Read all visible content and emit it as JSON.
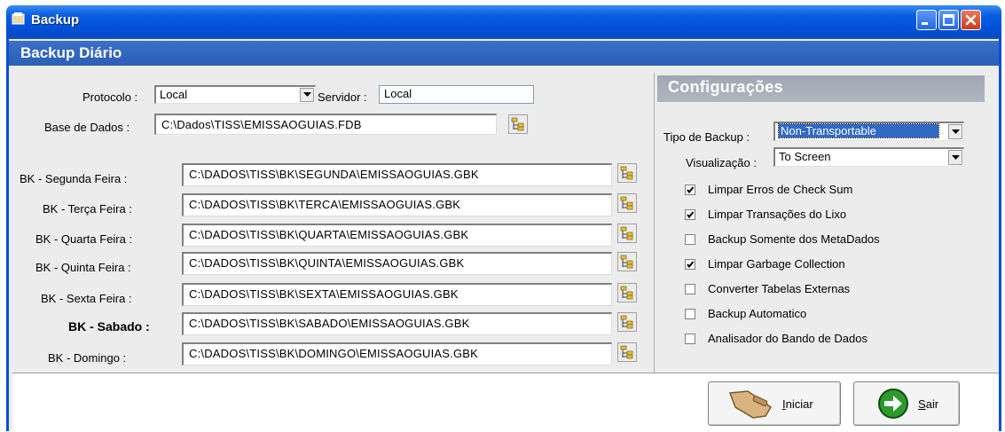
{
  "window": {
    "title": "Backup",
    "header": "Backup Diário"
  },
  "left": {
    "protocolo_label": "Protocolo :",
    "protocolo_value": "Local",
    "servidor_label": "Servidor :",
    "servidor_value": "Local",
    "base_label": "Base de Dados :",
    "base_value": "C:\\Dados\\TISS\\EMISSAOGUIAS.FDB",
    "days": [
      {
        "label": "BK - Segunda Feira :",
        "path": "C:\\DADOS\\TISS\\BK\\SEGUNDA\\EMISSAOGUIAS.GBK"
      },
      {
        "label": "BK - Terça Feira :",
        "path": "C:\\DADOS\\TISS\\BK\\TERCA\\EMISSAOGUIAS.GBK"
      },
      {
        "label": "BK - Quarta Feira :",
        "path": "C:\\DADOS\\TISS\\BK\\QUARTA\\EMISSAOGUIAS.GBK"
      },
      {
        "label": "BK - Quinta Feira :",
        "path": "C:\\DADOS\\TISS\\BK\\QUINTA\\EMISSAOGUIAS.GBK"
      },
      {
        "label": "BK - Sexta Feira :",
        "path": "C:\\DADOS\\TISS\\BK\\SEXTA\\EMISSAOGUIAS.GBK"
      },
      {
        "label": "BK - Sabado :",
        "path": "C:\\DADOS\\TISS\\BK\\SABADO\\EMISSAOGUIAS.GBK"
      },
      {
        "label": "BK - Domingo :",
        "path": "C:\\DADOS\\TISS\\BK\\DOMINGO\\EMISSAOGUIAS.GBK"
      }
    ]
  },
  "config": {
    "title": "Configurações",
    "tipo_label": "Tipo de Backup :",
    "tipo_value": "Non-Transportable",
    "visual_label": "Visualização :",
    "visual_value": "To Screen",
    "options": [
      {
        "label": "Limpar Erros de Check Sum",
        "checked": true
      },
      {
        "label": "Limpar Transações do Lixo",
        "checked": true
      },
      {
        "label": "Backup Somente dos MetaDados",
        "checked": false
      },
      {
        "label": "Limpar Garbage Collection",
        "checked": true
      },
      {
        "label": "Converter Tabelas Externas",
        "checked": false
      },
      {
        "label": "Backup Automatico",
        "checked": false
      },
      {
        "label": "Analisador do Bando de Dados",
        "checked": false
      }
    ]
  },
  "actions": {
    "iniciar_first": "I",
    "iniciar_rest": "niciar",
    "sair_first": "S",
    "sair_rest": "air"
  },
  "icons": {
    "app": "backup-app-icon",
    "minimize": "minimize-icon",
    "maximize": "maximize-icon",
    "close": "close-icon",
    "browse": "folder-tree-icon",
    "iniciar": "broom-icon",
    "sair": "exit-arrow-icon"
  },
  "colors": {
    "titlebar": "#0151d8",
    "header_band": "#2b5fb8",
    "config_band": "#aeb6bf",
    "selection": "#316ac5",
    "exit_icon": "#2e9a2e"
  }
}
